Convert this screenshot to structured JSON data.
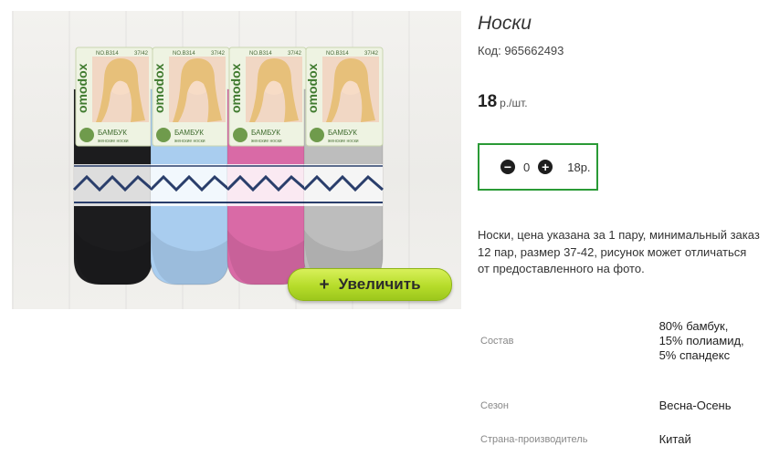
{
  "product": {
    "title": "Носки",
    "code": "Код: 965662493",
    "price_value": "18",
    "price_unit": "р./шт.",
    "description": "Носки, цена указана за 1 пару, минимальный заказ 12 пар, размер 37-42, рисунок может отличаться от предоставленного на фото."
  },
  "photo": {
    "zoom_plus": "+",
    "zoom_label": "Увеличить",
    "packs": [
      {
        "brand": "omodox",
        "sku": "NO.B314",
        "size": "37/42",
        "label": "БАМБУК",
        "sub": "женские носки",
        "color": "#1c1c1e"
      },
      {
        "brand": "omodox",
        "sku": "NO.B314",
        "size": "37/42",
        "label": "БАМБУК",
        "sub": "женские носки",
        "color": "#a9cdef"
      },
      {
        "brand": "omodox",
        "sku": "NO.B314",
        "size": "37/42",
        "label": "БАМБУК",
        "sub": "женские носки",
        "color": "#d96aa6"
      },
      {
        "brand": "omodox",
        "sku": "NO.B314",
        "size": "37/42",
        "label": "БАМБУК",
        "sub": "женские носки",
        "color": "#bdbdbd"
      }
    ]
  },
  "cart": {
    "minus_icon": "minus-circle-icon",
    "plus_icon": "plus-circle-icon",
    "quantity": "0",
    "total": "18р."
  },
  "properties": [
    {
      "name": "Состав",
      "value": "80% бамбук, 15% полиамид, 5% спандекс"
    },
    {
      "name": "Сезон",
      "value": "Весна-Осень"
    },
    {
      "name": "Страна-производитель",
      "value": "Китай"
    }
  ],
  "colors": {
    "accent_border": "#2a9a36",
    "zoom_button": "#b6dc2a"
  }
}
